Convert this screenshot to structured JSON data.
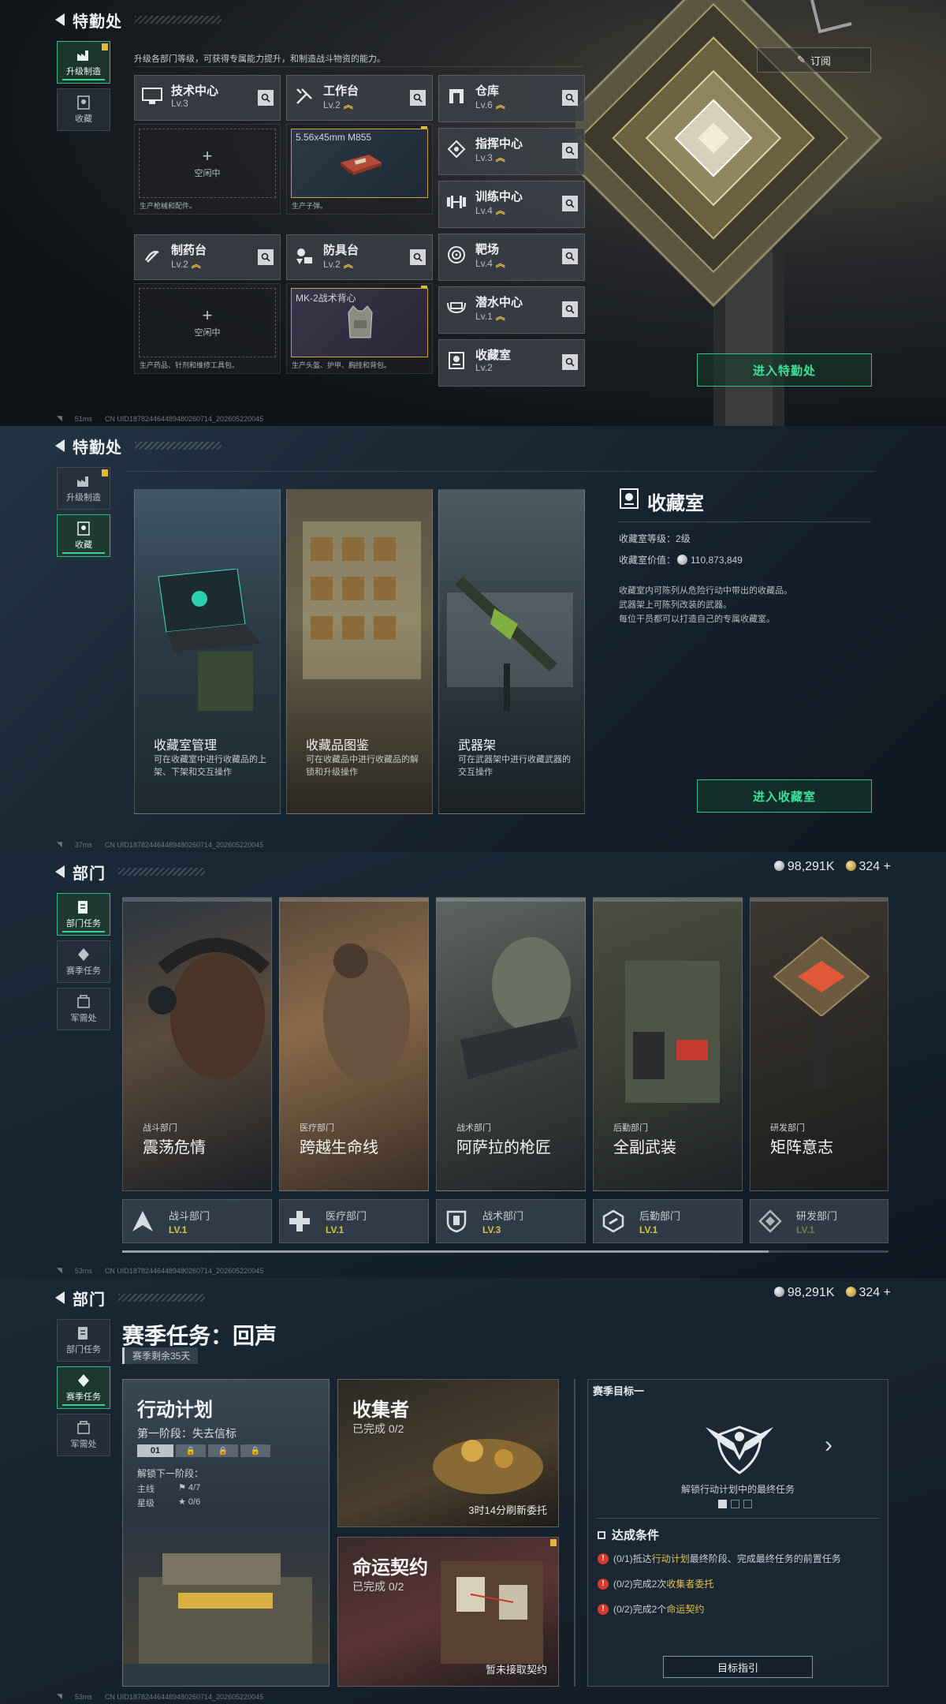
{
  "panel1": {
    "title": "特勤处",
    "sidebar": [
      {
        "label": "升级制造",
        "active": true,
        "badge": true
      },
      {
        "label": "收藏",
        "active": false,
        "badge": false
      }
    ],
    "description": "升级各部门等级，可获得专属能力提升，和制造战斗物资的能力。",
    "subscribe_label": "订阅",
    "facilities_left": [
      {
        "name": "技术中心",
        "level": "Lv.3",
        "upgradable": false,
        "icon": "monitor-icon",
        "slot_state": "空闲中",
        "slot_item": "",
        "slot_desc": "生产枪械和配件。"
      },
      {
        "name": "工作台",
        "level": "Lv.2",
        "upgradable": true,
        "icon": "tools-icon",
        "slot_state": "",
        "slot_item": "5.56x45mm M855",
        "slot_desc": "生产子弹。"
      },
      {
        "name": "制药台",
        "level": "Lv.2",
        "upgradable": true,
        "icon": "medicine-icon",
        "slot_state": "空闲中",
        "slot_item": "",
        "slot_desc": "生产药品、针剂和维修工具包。"
      },
      {
        "name": "防具台",
        "level": "Lv.2",
        "upgradable": true,
        "icon": "armor-icon",
        "slot_state": "",
        "slot_item": "MK-2战术背心",
        "slot_desc": "生产头盔、护甲、胸挂和背包。"
      }
    ],
    "facilities_right": [
      {
        "name": "仓库",
        "level": "Lv.6",
        "upgradable": true,
        "icon": "warehouse-icon"
      },
      {
        "name": "指挥中心",
        "level": "Lv.3",
        "upgradable": true,
        "icon": "command-icon"
      },
      {
        "name": "训练中心",
        "level": "Lv.4",
        "upgradable": true,
        "icon": "dumbbell-icon"
      },
      {
        "name": "靶场",
        "level": "Lv.4",
        "upgradable": true,
        "icon": "target-icon"
      },
      {
        "name": "潜水中心",
        "level": "Lv.1",
        "upgradable": true,
        "icon": "dive-icon"
      },
      {
        "name": "收藏室",
        "level": "Lv.2",
        "upgradable": false,
        "icon": "collection-icon"
      }
    ],
    "enter_label": "进入特勤处",
    "footer_ping": "51ms",
    "footer_uid": "CN UID187824464489480260714_202605220045"
  },
  "panel2": {
    "title": "特勤处",
    "sidebar": [
      {
        "label": "升级制造",
        "active": false,
        "badge": true
      },
      {
        "label": "收藏",
        "active": true,
        "badge": false
      }
    ],
    "cards": [
      {
        "title": "收藏室管理",
        "desc": "可在收藏室中进行收藏品的上架、下架和交互操作"
      },
      {
        "title": "收藏品图鉴",
        "desc": "可在收藏品中进行收藏品的解锁和升级操作"
      },
      {
        "title": "武器架",
        "desc": "可在武器架中进行收藏武器的交互操作"
      }
    ],
    "room_title": "收藏室",
    "room_level_label": "收藏室等级：",
    "room_level": "2级",
    "room_value_label": "收藏室价值：",
    "room_value": "110,873,849",
    "room_desc": [
      "收藏室内可陈列从危险行动中带出的收藏品。",
      "武器架上可陈列改装的武器。",
      "每位干员都可以打造自己的专属收藏室。"
    ],
    "enter_label": "进入收藏室",
    "footer_ping": "37ms",
    "footer_uid": "CN UID187824464489480260714_202605220045"
  },
  "panel3": {
    "title": "部门",
    "currency_silver": "98,291K",
    "currency_gold": "324",
    "sidebar": [
      {
        "label": "部门任务",
        "active": true
      },
      {
        "label": "赛季任务",
        "active": false
      },
      {
        "label": "军需处",
        "active": false
      }
    ],
    "departments": [
      {
        "type": "战斗部门",
        "name": "震荡危情",
        "bar_name": "战斗部门",
        "level": "LV.1",
        "dim": false,
        "icon": "combat-icon"
      },
      {
        "type": "医疗部门",
        "name": "跨越生命线",
        "bar_name": "医疗部门",
        "level": "LV.1",
        "dim": false,
        "icon": "medical-cross-icon"
      },
      {
        "type": "战术部门",
        "name": "阿萨拉的枪匠",
        "bar_name": "战术部门",
        "level": "LV.3",
        "dim": false,
        "icon": "shield-icon"
      },
      {
        "type": "后勤部门",
        "name": "全副武装",
        "bar_name": "后勤部门",
        "level": "LV.1",
        "dim": false,
        "icon": "logistics-icon"
      },
      {
        "type": "研发部门",
        "name": "矩阵意志",
        "bar_name": "研发部门",
        "level": "LV.1",
        "dim": true,
        "icon": "research-icon"
      }
    ],
    "footer_ping": "53ms",
    "footer_uid": "CN UID187824464489480260714_202605220045"
  },
  "panel4": {
    "title": "部门",
    "currency_silver": "98,291K",
    "currency_gold": "324",
    "sidebar": [
      {
        "label": "部门任务",
        "active": false
      },
      {
        "label": "赛季任务",
        "active": true
      },
      {
        "label": "军需处",
        "active": false
      }
    ],
    "season_title": "赛季任务：回声",
    "season_remaining": "赛季剩余35天",
    "op": {
      "title": "行动计划",
      "stage": "第一阶段：失去信标",
      "stage_num": "01",
      "unlock_label": "解锁下一阶段：",
      "main_label": "主线",
      "main_progress": "4/7",
      "star_label": "星级",
      "star_progress": "0/6"
    },
    "collector": {
      "title": "收集者",
      "status": "已完成 0/2",
      "refresh": "3时14分刷新委托"
    },
    "contract": {
      "title": "命运契约",
      "status": "已完成 0/2",
      "note": "暂未接取契约"
    },
    "goal": {
      "header": "赛季目标一",
      "caption": "解锁行动计划中的最终任务",
      "conditions_title": "达成条件",
      "conditions": [
        {
          "pre": "(0/1)抵达",
          "hl": "行动计划",
          "post": "最终阶段、完成最终任务的前置任务"
        },
        {
          "pre": "(0/2)完成2次",
          "hl": "收集者委托",
          "post": ""
        },
        {
          "pre": "(0/2)完成2个",
          "hl": "命运契约",
          "post": ""
        }
      ],
      "guide_label": "目标指引"
    },
    "footer_ping": "53ms",
    "footer_uid": "CN UID187824464489480260714_202605220045"
  },
  "colors": {
    "accent_green": "#39d38f",
    "gold": "#e3c047",
    "warning_red": "#d83b2e"
  }
}
